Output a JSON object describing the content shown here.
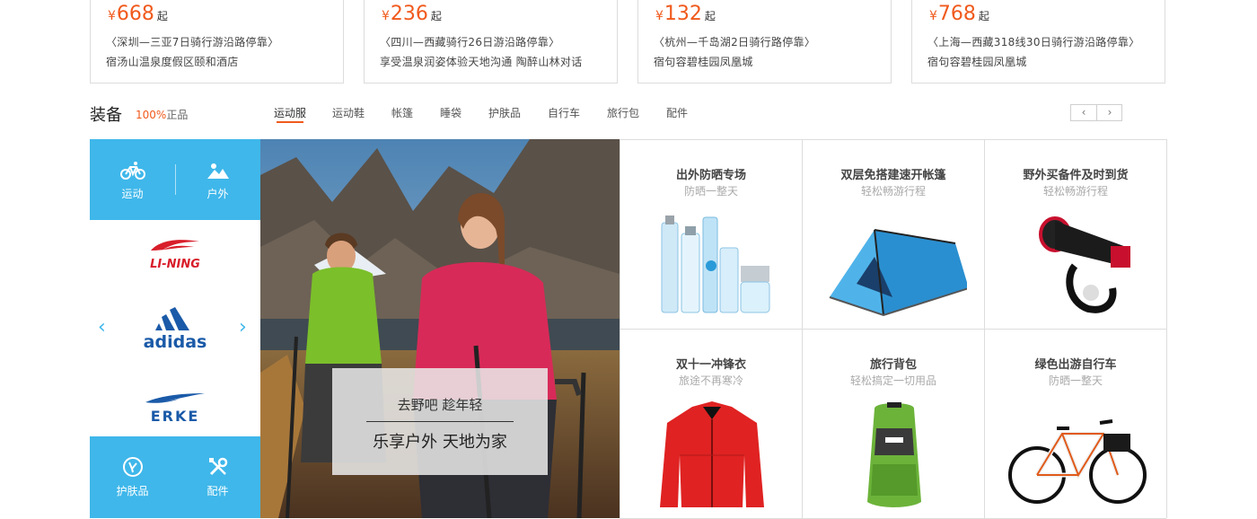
{
  "routes": [
    {
      "currency": "¥",
      "price": "668",
      "suffix": "起",
      "title": "〈深圳—三亚7日骑行游沿路停靠〉",
      "hotel": "宿汤山温泉度假区颐和酒店"
    },
    {
      "currency": "¥",
      "price": "236",
      "suffix": "起",
      "title": "〈四川—西藏骑行26日游沿路停靠〉",
      "hotel": "享受温泉润姿体验天地沟通  陶醉山林对话"
    },
    {
      "currency": "¥",
      "price": "132",
      "suffix": "起",
      "title": "〈杭州—千岛湖2日骑行路停靠〉",
      "hotel": "宿句容碧桂园凤凰城"
    },
    {
      "currency": "¥",
      "price": "768",
      "suffix": "起",
      "title": "〈上海—西藏318线30日骑行游沿路停靠〉",
      "hotel": "宿句容碧桂园凤凰城"
    }
  ],
  "category": {
    "title": "装备",
    "percent": "100%",
    "genuine": "正品",
    "tabs": [
      "运动服",
      "运动鞋",
      "帐篷",
      "睡袋",
      "护肤品",
      "自行车",
      "旅行包",
      "配件"
    ],
    "active_tab": "运动服",
    "pager": {
      "prev": "‹",
      "next": "›"
    }
  },
  "side": {
    "top_items": [
      {
        "label": "运动",
        "icon": "bicycle-icon"
      },
      {
        "label": "户外",
        "icon": "landscape-icon"
      }
    ],
    "brands": [
      {
        "name": "LI-NING",
        "color": "#d81e2a"
      },
      {
        "name": "adidas",
        "color": "#1a5aa8"
      },
      {
        "name": "ERKE",
        "color": "#1a5aa8"
      }
    ],
    "bottom_items": [
      {
        "label": "护肤品",
        "icon": "skincare-icon"
      },
      {
        "label": "配件",
        "icon": "tools-icon"
      }
    ],
    "arrow_left": "‹",
    "arrow_right": "›"
  },
  "hero": {
    "line1": "去野吧 趁年轻",
    "line2": "乐享户外 天地为家"
  },
  "products": [
    {
      "title": "出外防晒专场",
      "sub": "防晒一整天",
      "icon": "skincare-bottles-icon"
    },
    {
      "title": "双层免搭建速开帐篷",
      "sub": "轻松畅游行程",
      "icon": "tent-icon"
    },
    {
      "title": "野外买备件及时到货",
      "sub": "轻松畅游行程",
      "icon": "bike-light-icon"
    },
    {
      "title": "双十一冲锋衣",
      "sub": "旅途不再寒冷",
      "icon": "jacket-icon"
    },
    {
      "title": "旅行背包",
      "sub": "轻松搞定一切用品",
      "icon": "backpack-icon"
    },
    {
      "title": "绿色出游自行车",
      "sub": "防晒一整天",
      "icon": "bicycle-product-icon"
    }
  ],
  "colors": {
    "accent": "#f05a1d",
    "brand_blue": "#3fb7ea"
  }
}
